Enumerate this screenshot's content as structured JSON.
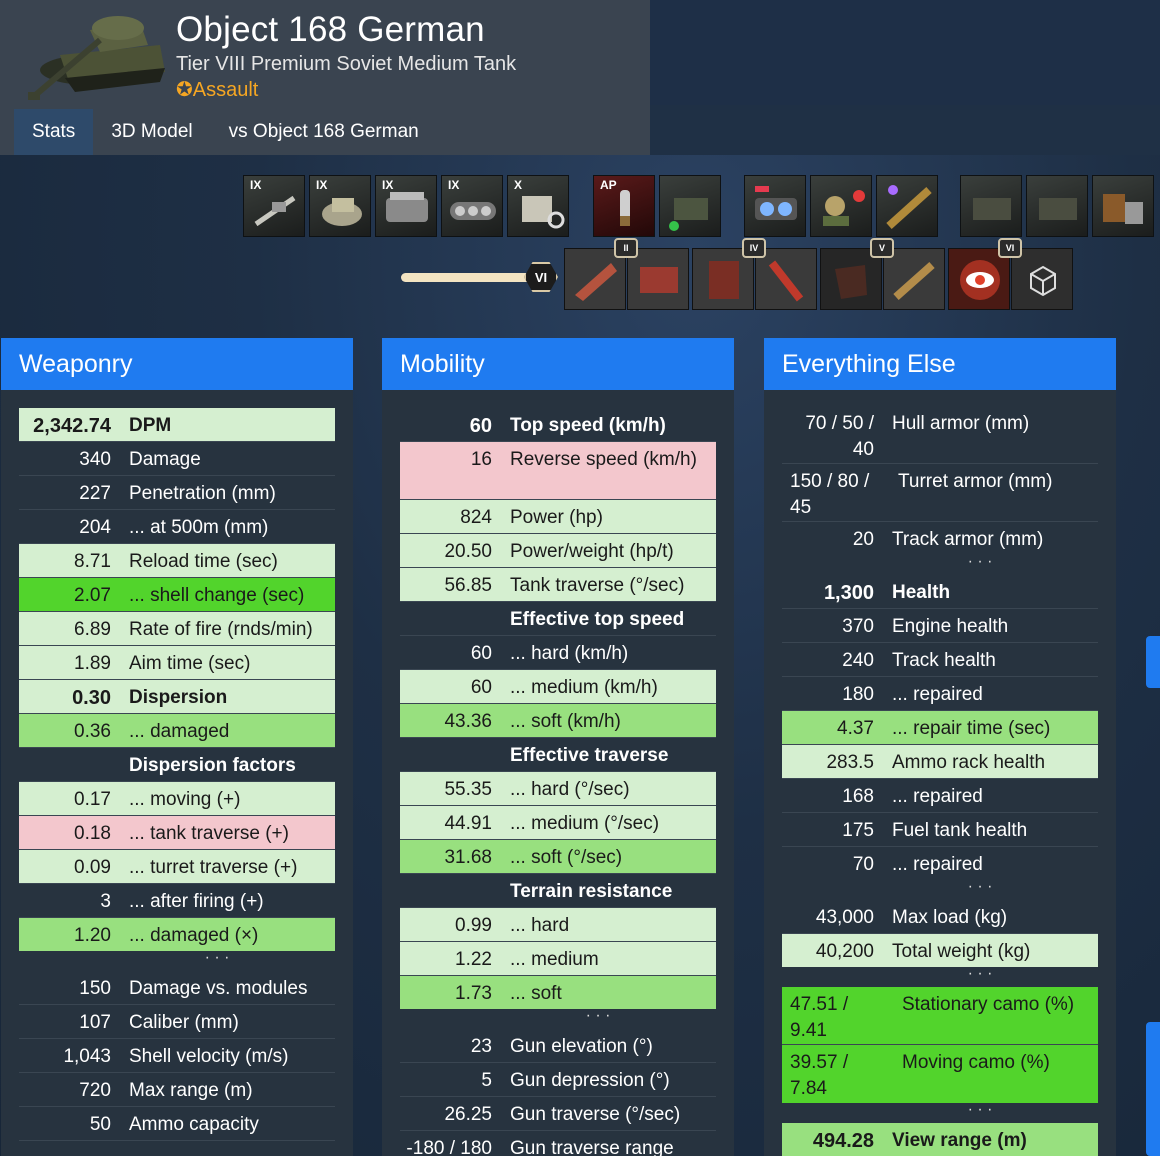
{
  "header": {
    "title": "Object 168 German",
    "subtitle": "Tier VIII Premium Soviet Medium Tank",
    "role": "Assault",
    "role_icon": "star-outline-icon"
  },
  "tabs": [
    {
      "label": "Stats"
    },
    {
      "label": "3D Model"
    },
    {
      "label": "vs Object 168 German"
    }
  ],
  "equipment": {
    "modules": [
      {
        "tier": "IX",
        "icon": "gun-icon"
      },
      {
        "tier": "IX",
        "icon": "turret-icon"
      },
      {
        "tier": "IX",
        "icon": "engine-icon"
      },
      {
        "tier": "IX",
        "icon": "tracks-icon"
      },
      {
        "tier": "X",
        "icon": "radio-icon"
      }
    ],
    "ammo": [
      {
        "tier": "AP",
        "icon": "shell-icon"
      },
      {
        "tier": "",
        "icon": "consumable-box-icon"
      }
    ],
    "devices": [
      {
        "icon": "optics-icon"
      },
      {
        "icon": "crew-icon"
      },
      {
        "icon": "rammer-icon"
      }
    ],
    "consumables": [
      {
        "icon": "crate-icon"
      },
      {
        "icon": "crate-icon"
      },
      {
        "icon": "fuel-barrels-icon"
      }
    ],
    "skill_level": "VI",
    "skill_pills": [
      "II",
      "IV",
      "V",
      "VI"
    ],
    "field_mod_icons": [
      "gun-part-icon",
      "engine-part-icon",
      "suspension-icon",
      "wrench-icon",
      "turret-part-icon",
      "rammer-part-icon",
      "vision-eye-icon",
      "cube-icon"
    ]
  },
  "weaponry": {
    "title": "Weaponry",
    "rows": [
      {
        "v": "2,342.74",
        "l": "DPM"
      },
      {
        "v": "340",
        "l": "Damage"
      },
      {
        "v": "227",
        "l": "Penetration (mm)"
      },
      {
        "v": "204",
        "l": "... at 500m (mm)"
      },
      {
        "v": "8.71",
        "l": "Reload time (sec)"
      },
      {
        "v": "2.07",
        "l": "... shell change (sec)"
      },
      {
        "v": "6.89",
        "l": "Rate of fire (rnds/min)"
      },
      {
        "v": "1.89",
        "l": "Aim time (sec)"
      },
      {
        "v": "0.30",
        "l": "Dispersion"
      },
      {
        "v": "0.36",
        "l": "... damaged"
      },
      {
        "v": "",
        "l": "Dispersion factors"
      },
      {
        "v": "0.17",
        "l": "... moving (+)"
      },
      {
        "v": "0.18",
        "l": "... tank traverse (+)"
      },
      {
        "v": "0.09",
        "l": "... turret traverse (+)"
      },
      {
        "v": "3",
        "l": "... after firing (+)"
      },
      {
        "v": "1.20",
        "l": "... damaged (×)"
      },
      {
        "v": "150",
        "l": "Damage vs. modules"
      },
      {
        "v": "107",
        "l": "Caliber (mm)"
      },
      {
        "v": "1,043",
        "l": "Shell velocity (m/s)"
      },
      {
        "v": "720",
        "l": "Max range (m)"
      },
      {
        "v": "50",
        "l": "Ammo capacity"
      }
    ]
  },
  "mobility": {
    "title": "Mobility",
    "rows": [
      {
        "v": "60",
        "l": "Top speed (km/h)"
      },
      {
        "v": "16",
        "l": "Reverse speed (km/h)"
      },
      {
        "v": "824",
        "l": "Power (hp)"
      },
      {
        "v": "20.50",
        "l": "Power/weight (hp/t)"
      },
      {
        "v": "56.85",
        "l": "Tank traverse (°/sec)"
      },
      {
        "v": "",
        "l": "Effective top speed"
      },
      {
        "v": "60",
        "l": "... hard (km/h)"
      },
      {
        "v": "60",
        "l": "... medium (km/h)"
      },
      {
        "v": "43.36",
        "l": "... soft (km/h)"
      },
      {
        "v": "",
        "l": "Effective traverse"
      },
      {
        "v": "55.35",
        "l": "... hard (°/sec)"
      },
      {
        "v": "44.91",
        "l": "... medium (°/sec)"
      },
      {
        "v": "31.68",
        "l": "... soft (°/sec)"
      },
      {
        "v": "",
        "l": "Terrain resistance"
      },
      {
        "v": "0.99",
        "l": "... hard"
      },
      {
        "v": "1.22",
        "l": "... medium"
      },
      {
        "v": "1.73",
        "l": "... soft"
      },
      {
        "v": "23",
        "l": "Gun elevation (°)"
      },
      {
        "v": "5",
        "l": "Gun depression (°)"
      },
      {
        "v": "26.25",
        "l": "Gun traverse (°/sec)"
      },
      {
        "v": "-180 / 180",
        "l": "Gun traverse range"
      }
    ]
  },
  "else": {
    "title": "Everything Else",
    "rows": [
      {
        "v": "70 / 50 / 40",
        "l": "Hull armor (mm)"
      },
      {
        "v": "150 / 80 / 45",
        "l": "Turret armor (mm)"
      },
      {
        "v": "20",
        "l": "Track armor (mm)"
      },
      {
        "v": "1,300",
        "l": "Health"
      },
      {
        "v": "370",
        "l": "Engine health"
      },
      {
        "v": "240",
        "l": "Track health"
      },
      {
        "v": "180",
        "l": "... repaired"
      },
      {
        "v": "4.37",
        "l": "... repair time (sec)"
      },
      {
        "v": "283.5",
        "l": "Ammo rack health"
      },
      {
        "v": "168",
        "l": "... repaired"
      },
      {
        "v": "175",
        "l": "Fuel tank health"
      },
      {
        "v": "70",
        "l": "... repaired"
      },
      {
        "v": "43,000",
        "l": "Max load (kg)"
      },
      {
        "v": "40,200",
        "l": "Total weight (kg)"
      },
      {
        "v": "47.51 / 9.41",
        "l": "Stationary camo (%)"
      },
      {
        "v": "39.57 / 7.84",
        "l": "Moving camo (%)"
      },
      {
        "v": "494.28",
        "l": "View range (m)"
      }
    ]
  },
  "ellipsis": "· · ·",
  "colors": {
    "accent": "#1f7bf0",
    "good_light": "#d5efd0",
    "good_mid": "#98e07f",
    "good_dark": "#52d42c",
    "bad": "#f3c7cd",
    "role": "#f5a623"
  }
}
